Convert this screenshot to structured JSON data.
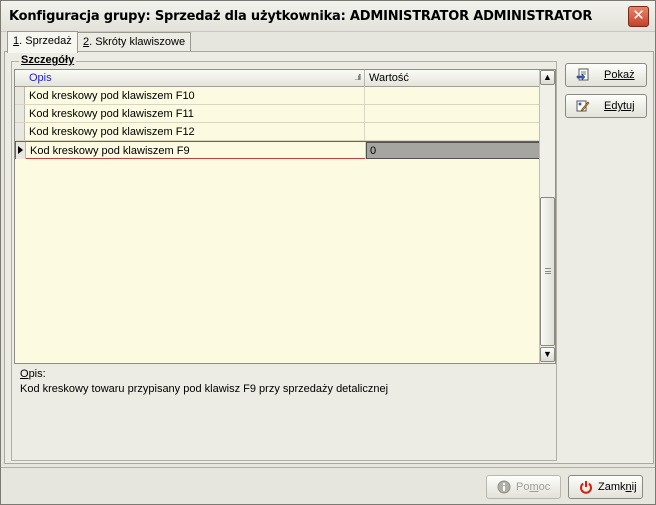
{
  "window": {
    "title": "Konfiguracja grupy: Sprzedaż dla użytkownika: ADMINISTRATOR ADMINISTRATOR",
    "close_glyph": "✕"
  },
  "tabs": [
    {
      "key": "1",
      "label": ". Sprzedaż",
      "active": true
    },
    {
      "key": "2",
      "label": ". Skróty klawiszowe",
      "active": false
    }
  ],
  "details": {
    "group_label": "Szczegóły",
    "columns": {
      "opis": "Opis",
      "wartosc": "Wartość"
    },
    "rows": [
      {
        "opis": "Kod kreskowy pod klawiszem F10",
        "wartosc": ""
      },
      {
        "opis": "Kod kreskowy pod klawiszem F11",
        "wartosc": ""
      },
      {
        "opis": "Kod kreskowy pod klawiszem F12",
        "wartosc": ""
      },
      {
        "opis": "Kod kreskowy pod klawiszem F9",
        "wartosc": "0"
      }
    ],
    "selected_row": 3
  },
  "description": {
    "label_key": "O",
    "label_rest": "pis:",
    "text": "Kod kreskowy towaru przypisany pod klawisz F9 przy sprzedaży detalicznej"
  },
  "side_buttons": {
    "show": {
      "label": "Pokaż",
      "icon": "show-icon"
    },
    "edit": {
      "label": "Edytuj",
      "icon": "edit-icon"
    }
  },
  "footer": {
    "help": {
      "label_pre": "Po",
      "label_key": "m",
      "label_post": "oc",
      "icon": "info-icon",
      "disabled": true
    },
    "close": {
      "label_pre": "Zamk",
      "label_key": "n",
      "label_post": "ij",
      "icon": "power-icon"
    }
  },
  "colors": {
    "grid_bg": "#fcfae0",
    "header_opis": "#1f1fc0",
    "close_red": "#c4412a",
    "selected_border": "#c04040"
  }
}
